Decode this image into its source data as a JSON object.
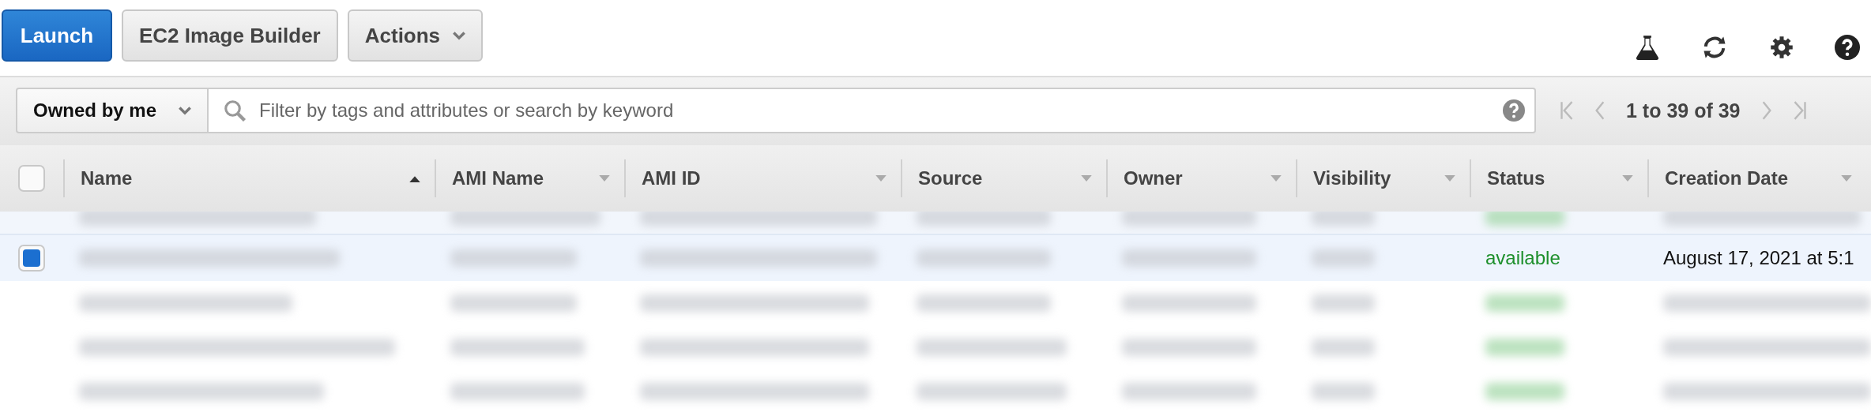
{
  "toolbar": {
    "buttons": [
      {
        "label": "Launch",
        "kind": "primary"
      },
      {
        "label": "EC2 Image Builder",
        "kind": "plain"
      },
      {
        "label": "Actions",
        "kind": "menu"
      }
    ]
  },
  "filter": {
    "owner": "Owned by me",
    "placeholder": "Filter by tags and attributes or search by keyword"
  },
  "pagination": {
    "range": "1 to 39 of 39"
  },
  "table": {
    "select_all_checked": false,
    "columns": [
      {
        "label": "Name",
        "sorted": true
      },
      {
        "label": "AMI Name",
        "sorted": false
      },
      {
        "label": "AMI ID",
        "sorted": false
      },
      {
        "label": "Source",
        "sorted": false
      },
      {
        "label": "Owner",
        "sorted": false
      },
      {
        "label": "Visibility",
        "sorted": false
      },
      {
        "label": "Status",
        "sorted": false
      },
      {
        "label": "Creation Date",
        "sorted": false
      }
    ],
    "rows": [
      {
        "selected": false,
        "partial": true
      },
      {
        "selected": true,
        "status": "available",
        "creation_date": "August 17, 2021 at 5:1"
      },
      {
        "selected": false
      },
      {
        "selected": false
      },
      {
        "selected": false
      }
    ]
  }
}
